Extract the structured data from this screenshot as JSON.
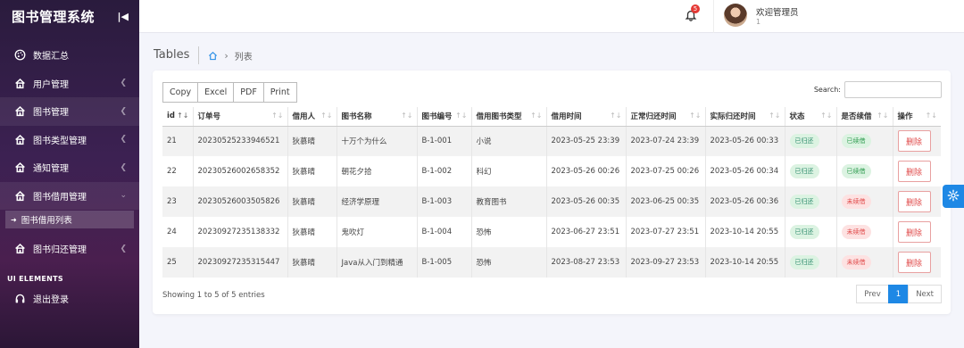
{
  "sidebar": {
    "title": "图书管理系统",
    "items": [
      {
        "label": "数据汇总",
        "icon": "palette-icon",
        "has_arrow": false
      },
      {
        "label": "用户管理",
        "icon": "home-icon",
        "has_arrow": true
      },
      {
        "label": "图书管理",
        "icon": "home-icon",
        "has_arrow": true
      },
      {
        "label": "图书类型管理",
        "icon": "home-icon",
        "has_arrow": true
      },
      {
        "label": "通知管理",
        "icon": "home-icon",
        "has_arrow": true
      },
      {
        "label": "图书借用管理",
        "icon": "home-icon",
        "has_arrow": true,
        "expanded": true
      }
    ],
    "subitem": "图书借用列表",
    "item_return": "图书归还管理",
    "section_label": "UI ELEMENTS",
    "logout": "退出登录"
  },
  "header": {
    "notification_count": "5",
    "welcome": "欢迎管理员",
    "user_number": "1"
  },
  "breadcrumb": {
    "title": "Tables",
    "current": "列表"
  },
  "toolbar": {
    "buttons": [
      "Copy",
      "Excel",
      "PDF",
      "Print"
    ],
    "search_label": "Search:"
  },
  "table": {
    "headers": [
      "id",
      "订单号",
      "借用人",
      "图书名称",
      "图书编号",
      "借用图书类型",
      "借用时间",
      "正常归还时间",
      "实际归还时间",
      "状态",
      "是否续借",
      "操作"
    ],
    "rows": [
      {
        "id": "21",
        "order": "20230525233946521",
        "borrower": "狄慕晴",
        "book": "十万个为什么",
        "code": "B-1-001",
        "type": "小说",
        "borrow_time": "2023-05-25 23:39",
        "due_time": "2023-07-24 23:39",
        "return_time": "2023-05-26 00:33",
        "status": "已归还",
        "renew": "已续借",
        "renew_color": "green",
        "action": "删除"
      },
      {
        "id": "22",
        "order": "20230526002658352",
        "borrower": "狄慕晴",
        "book": "朝花夕拾",
        "code": "B-1-002",
        "type": "科幻",
        "borrow_time": "2023-05-26 00:26",
        "due_time": "2023-07-25 00:26",
        "return_time": "2023-05-26 00:34",
        "status": "已归还",
        "renew": "已续借",
        "renew_color": "green",
        "action": "删除"
      },
      {
        "id": "23",
        "order": "20230526003505826",
        "borrower": "狄慕晴",
        "book": "经济学原理",
        "code": "B-1-003",
        "type": "教育图书",
        "borrow_time": "2023-05-26 00:35",
        "due_time": "2023-06-25 00:35",
        "return_time": "2023-05-26 00:36",
        "status": "已归还",
        "renew": "未续借",
        "renew_color": "red",
        "action": "删除"
      },
      {
        "id": "24",
        "order": "20230927235138332",
        "borrower": "狄慕晴",
        "book": "鬼吹灯",
        "code": "B-1-004",
        "type": "恐怖",
        "borrow_time": "2023-06-27 23:51",
        "due_time": "2023-07-27 23:51",
        "return_time": "2023-10-14 20:55",
        "status": "已归还",
        "renew": "未续借",
        "renew_color": "red",
        "action": "删除"
      },
      {
        "id": "25",
        "order": "20230927235315447",
        "borrower": "狄慕晴",
        "book": "Java从入门到精通",
        "code": "B-1-005",
        "type": "恐怖",
        "borrow_time": "2023-08-27 23:53",
        "due_time": "2023-09-27 23:53",
        "return_time": "2023-10-14 20:55",
        "status": "已归还",
        "renew": "未续借",
        "renew_color": "red",
        "action": "删除"
      }
    ]
  },
  "footer": {
    "info": "Showing 1 to 5 of 5 entries",
    "prev": "Prev",
    "page": "1",
    "next": "Next"
  },
  "colors": {
    "accent": "#1e88e5",
    "danger": "#e04a4a",
    "success": "#2e9b4f"
  }
}
